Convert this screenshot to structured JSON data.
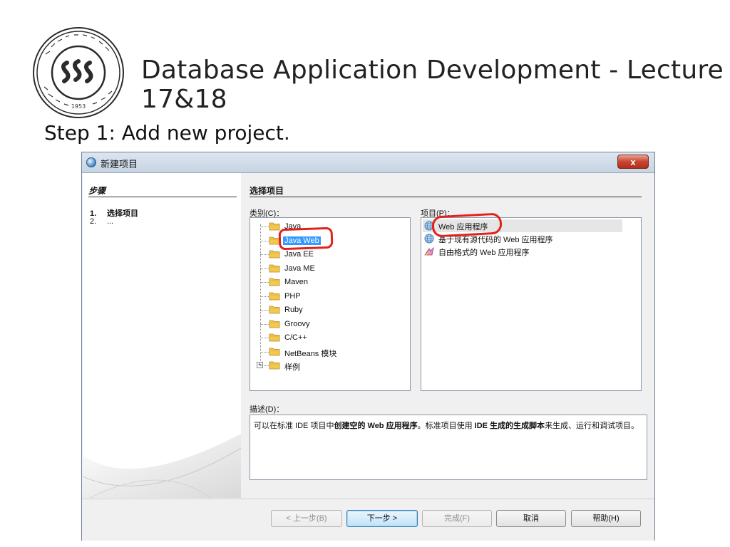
{
  "slide": {
    "title": "Database Application Development - Lecture 17&18",
    "step_caption": "Step 1: Add new project.",
    "logo_year": "1953"
  },
  "dialog": {
    "title": "新建项目",
    "close_label": "x",
    "steps_header": "步骤",
    "steps": [
      {
        "num": "1.",
        "label": "选择项目"
      },
      {
        "num": "2.",
        "label": "..."
      }
    ],
    "section_title": "选择项目",
    "category_label": "类别(C)：",
    "project_label": "项目(P)：",
    "categories": [
      "Java",
      "Java Web",
      "Java EE",
      "Java ME",
      "Maven",
      "PHP",
      "Ruby",
      "Groovy",
      "C/C++",
      "NetBeans 模块",
      "样例"
    ],
    "selected_category": "Java Web",
    "projects": [
      {
        "label": "Web 应用程序",
        "icon": "globe-icon"
      },
      {
        "label": "基于现有源代码的 Web 应用程序",
        "icon": "globe-icon"
      },
      {
        "label": "自由格式的 Web 应用程序",
        "icon": "freeform-icon"
      }
    ],
    "description_label": "描述(D)：",
    "description": {
      "p1": "可以在标准 IDE 项目中",
      "b1": "创建空的 Web 应用程序",
      "p2": "。标准项目使用 ",
      "b2": "IDE 生成的生成脚本",
      "p3": "来生成、运行和调试项目。"
    },
    "buttons": {
      "back": "< 上一步(B)",
      "next": "下一步 >",
      "finish": "完成(F)",
      "cancel": "取消",
      "help": "帮助(H)"
    }
  },
  "colors": {
    "selection": "#3399ff",
    "annotation": "#e2211c",
    "close_button": "#c7452f"
  }
}
